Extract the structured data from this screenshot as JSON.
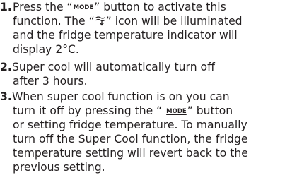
{
  "step1": {
    "number": "1.",
    "line1_before": "Press the “",
    "mode_label": "MODE",
    "line1_after": "” button to activate this",
    "line2_before": "function. The “",
    "icon": "super-cool-icon",
    "line2_after": "” icon will be illuminated",
    "line3": "and the fridge temperature indicator will",
    "line4": "display 2°C."
  },
  "step2": {
    "number": "2.",
    "line1": "Super cool will automatically turn off",
    "line2": "after 3 hours."
  },
  "step3": {
    "number": "3.",
    "line1": "When super cool function is on you can",
    "line2_before": "turn it off by pressing the “ ",
    "mode_label": "MODE",
    "line2_after": "” button",
    "line3": "or setting fridge temperature. To manually",
    "line4": "turn off the Super Cool function, the fridge",
    "line5": "temperature setting will revert back to the",
    "line6": "previous setting."
  }
}
